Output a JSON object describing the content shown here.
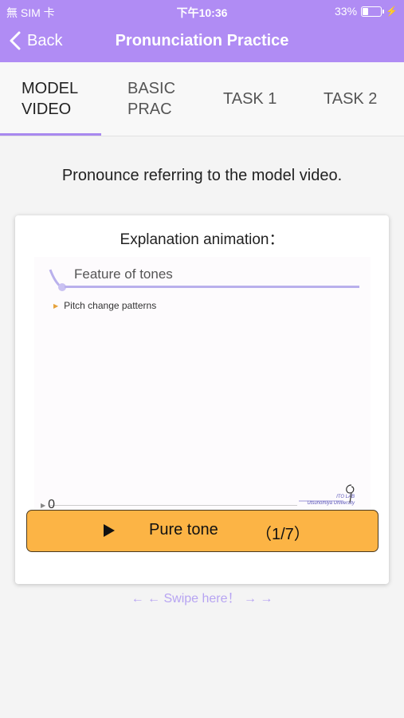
{
  "status_bar": {
    "carrier": "無 SIM 卡",
    "time": "下午10:36",
    "battery_percent": "33%",
    "battery_level": 0.33
  },
  "nav": {
    "back_label": "Back",
    "title": "Pronunciation Practice"
  },
  "tabs": [
    {
      "label": "MODEL\nVIDEO",
      "active": true
    },
    {
      "label": "BASIC\nPRAC",
      "active": false
    },
    {
      "label": "TASK 1",
      "active": false
    },
    {
      "label": "TASK 2",
      "active": false
    }
  ],
  "instruction": "Pronounce referring to the model video.",
  "card": {
    "title": "Explanation animation：",
    "video": {
      "heading": "Feature of tones",
      "bullet": "Pitch change patterns",
      "watermark_line1": "ITO  LAB",
      "watermark_line2": "Utsunomiya University",
      "frame_counter": "0"
    },
    "play_button": {
      "label": "Pure tone",
      "count": "（1/7）"
    }
  },
  "swipe_hint": "←   ←   Swipe here！ →  →",
  "colors": {
    "accent": "#b08cf4",
    "tab_indicator": "#a889ef",
    "button": "#fcb445",
    "swipe_text": "#b7a4f2"
  }
}
